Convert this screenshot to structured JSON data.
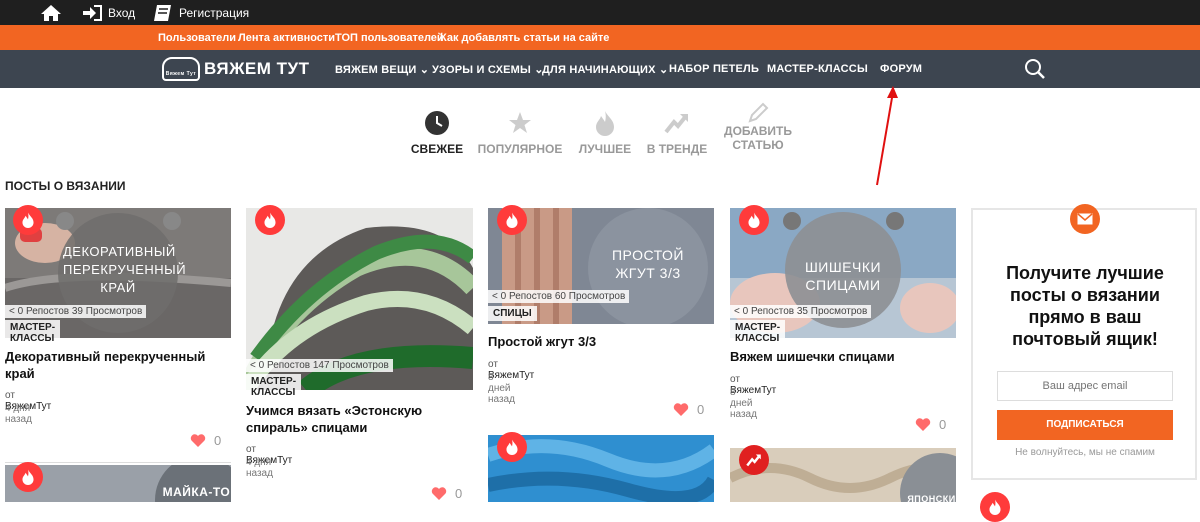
{
  "topbar": {
    "login": "Вход",
    "register": "Регистрация"
  },
  "orange_links": [
    "Пользователи",
    "Лента активности",
    "ТОП пользователей",
    "Как добавлять статьи на сайте"
  ],
  "logo": {
    "text": "Вяжем тут",
    "badge": "Вяжем Тут"
  },
  "nav": [
    "ВЯЖЕМ ВЕЩИ",
    "УЗОРЫ И СХЕМЫ",
    "ДЛЯ НАЧИНАЮЩИХ",
    "НАБОР ПЕТЕЛЬ",
    "МАСТЕР-КЛАССЫ",
    "ФОРУМ"
  ],
  "tabs": [
    {
      "label": "СВЕЖЕЕ",
      "icon": "clock-icon"
    },
    {
      "label": "ПОПУЛЯРНОЕ",
      "icon": "star-icon"
    },
    {
      "label": "ЛУЧШЕЕ",
      "icon": "fire-icon"
    },
    {
      "label": "В ТРЕНДЕ",
      "icon": "trend-icon"
    },
    {
      "label1": "ДОБАВИТЬ",
      "label2": "СТАТЬЮ",
      "icon": "pencil-icon"
    }
  ],
  "section_title": "ПОСТЫ О ВЯЗАНИИ",
  "posts": [
    {
      "overlay": "ДЕКОРАТИВНЫЙ ПЕРЕКРУЧЕННЫЙ КРАЙ",
      "stats": "0 Репостов   39 Просмотров",
      "category": "МАСТЕР-КЛАССЫ",
      "title": "Декоративный перекрученный край",
      "author_prefix": "от",
      "author": "ВяжемТут",
      "date": "4 дня назад",
      "likes": "0"
    },
    {
      "overlay": "",
      "stats": "0 Репостов   147 Просмотров",
      "category": "МАСТЕР-КЛАССЫ",
      "title": "Учимся вязать «Эстонскую спираль» спицами",
      "author_prefix": "от",
      "author": "ВяжемТут",
      "date": "4 дня назад",
      "likes": "0"
    },
    {
      "overlay": "ПРОСТОЙ ЖГУТ 3/3",
      "stats": "0 Репостов   60 Просмотров",
      "category": "СПИЦЫ",
      "title": "Простой жгут 3/3",
      "author_prefix": "от",
      "author": "ВяжемТут",
      "date": "8 дней назад",
      "likes": "0"
    },
    {
      "overlay": "ШИШЕЧКИ СПИЦАМИ",
      "stats": "0 Репостов   35 Просмотров",
      "category": "МАСТЕР-КЛАССЫ",
      "title": "Вяжем шишечки спицами",
      "author_prefix": "от",
      "author": "ВяжемТут",
      "date": "8 дней назад",
      "likes": "0"
    }
  ],
  "bottom_cards": {
    "first_overlay": "МАЙКА-ТОП",
    "fourth_overlay": "ЯПОНСКИЙ"
  },
  "newsletter": {
    "headline": "Получите лучшие посты о вязании прямо в ваш почтовый ящик!",
    "placeholder": "Ваш адрес email",
    "button": "ПОДПИСАТЬСЯ",
    "note": "Не волнуйтесь, мы не спамим"
  },
  "colors": {
    "accent": "#f26522",
    "nav_bg": "#3d4550",
    "top_bg": "#1f1f1f",
    "fire": "#ff3b3b"
  }
}
